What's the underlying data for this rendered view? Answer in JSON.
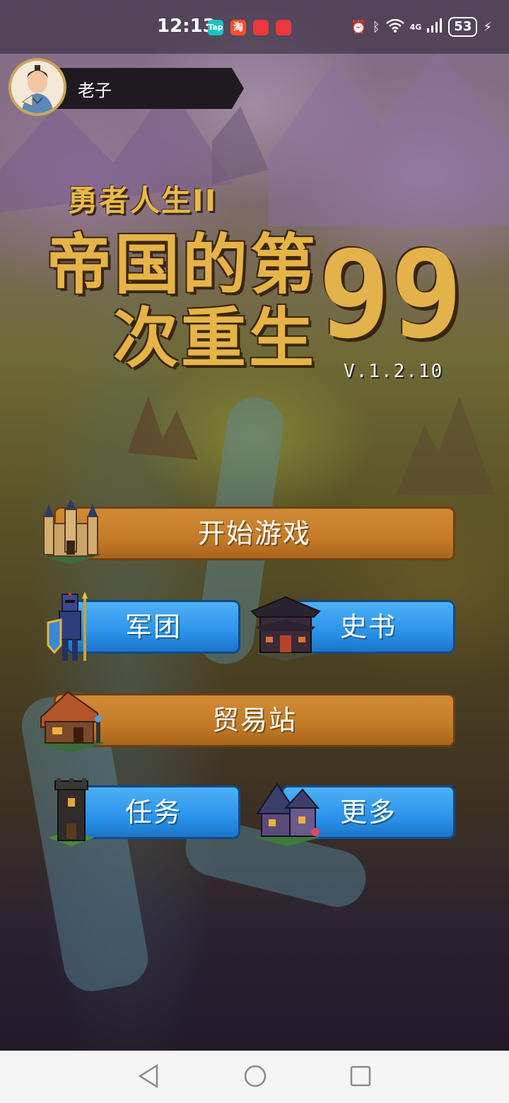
{
  "status_bar": {
    "time": "12:13",
    "apps": [
      {
        "name": "taptap-icon",
        "label": "Tap",
        "color": "#1ac4c4"
      },
      {
        "name": "taobao-icon",
        "label": "淘",
        "color": "#ff4d2d"
      },
      {
        "name": "redpacket-icon-1",
        "label": "",
        "color": "#e8393b"
      },
      {
        "name": "redpacket-icon-2",
        "label": "",
        "color": "#e8393b"
      }
    ],
    "network": "4G",
    "battery": "53"
  },
  "player": {
    "name": "老子"
  },
  "title": {
    "subtitle": "勇者人生II",
    "line1": "帝国的第",
    "line2": "次重生",
    "number": "99",
    "version": "V.1.2.10"
  },
  "menu": {
    "start": "开始游戏",
    "legion": "军团",
    "history": "史书",
    "trade": "贸易站",
    "quest": "任务",
    "more": "更多"
  },
  "colors": {
    "orange_button": "#c47b27",
    "blue_button": "#2a93ea",
    "title_gold": "#e6b446"
  }
}
